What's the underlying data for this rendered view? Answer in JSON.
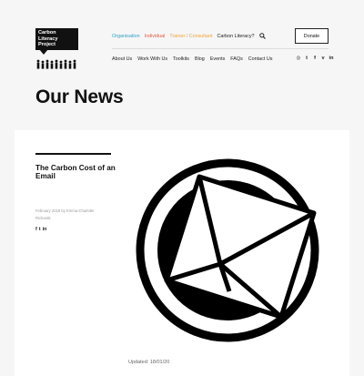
{
  "header": {
    "logo_lines": [
      "Carbon Literacy",
      "Project"
    ],
    "top_nav": [
      "Organisation",
      "Individual",
      "Trainer / Consultant",
      "Carbon Literacy?"
    ],
    "donate_label": "Donate",
    "main_nav": [
      "About Us",
      "Work With Us",
      "Toolkits",
      "Blog",
      "Events",
      "FAQs",
      "Contact Us"
    ],
    "social_icons": [
      "instagram-icon",
      "twitter-icon",
      "facebook-icon",
      "vimeo-icon",
      "linkedin-icon"
    ]
  },
  "page": {
    "title": "Our News"
  },
  "article": {
    "title": "The Carbon Cost of an Email",
    "meta": "February 2018 by Emma-Charlotte Richards",
    "share_icons": [
      "facebook-icon",
      "twitter-icon",
      "linkedin-icon"
    ],
    "updated": "Updated: 18/01/20",
    "image": "envelope-icon"
  }
}
